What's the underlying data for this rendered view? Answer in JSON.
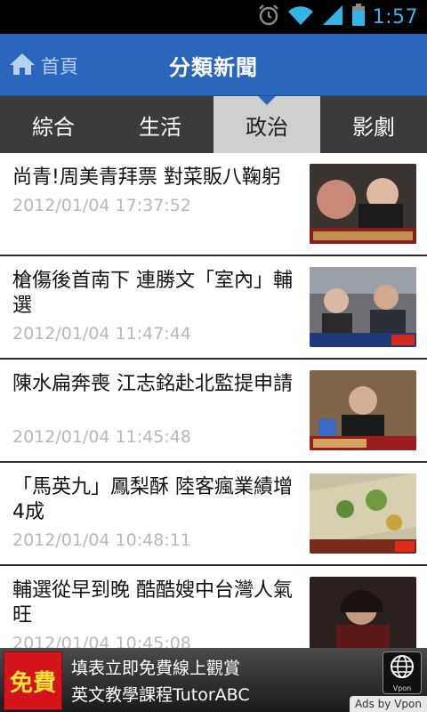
{
  "status_bar": {
    "time": "1:57",
    "icons": [
      "alarm-icon",
      "wifi-icon",
      "signal-icon",
      "battery-icon"
    ]
  },
  "header": {
    "home_label": "首頁",
    "title": "分類新聞"
  },
  "tabs": [
    {
      "label": "綜合",
      "active": false
    },
    {
      "label": "生活",
      "active": false
    },
    {
      "label": "政治",
      "active": true
    },
    {
      "label": "影劇",
      "active": false
    }
  ],
  "news": [
    {
      "title": "尚青!周美青拜票 對菜販八鞠躬",
      "time": "2012/01/04 17:37:52"
    },
    {
      "title": "槍傷後首南下 連勝文「室內」輔選",
      "time": "2012/01/04 11:47:44"
    },
    {
      "title": "陳水扁奔喪 江志銘赴北監提申請",
      "time": "2012/01/04 11:45:48"
    },
    {
      "title": "「馬英九」鳳梨酥 陸客瘋業績增4成",
      "time": "2012/01/04 10:48:11"
    },
    {
      "title": "輔選從早到晚 酷酷嫂中台灣人氣旺",
      "time": "2012/01/04 10:45:08"
    }
  ],
  "ad": {
    "badge": "免費",
    "line1": "填表立即免費線上觀賞",
    "line2": "英文教學課程TutorABC",
    "logo_text": "Vpon",
    "credit": "Ads by Vpon"
  },
  "colors": {
    "appbar": "#2a66b9",
    "tab_active": "#cfcfcf",
    "status_accent": "#35b5e5"
  }
}
